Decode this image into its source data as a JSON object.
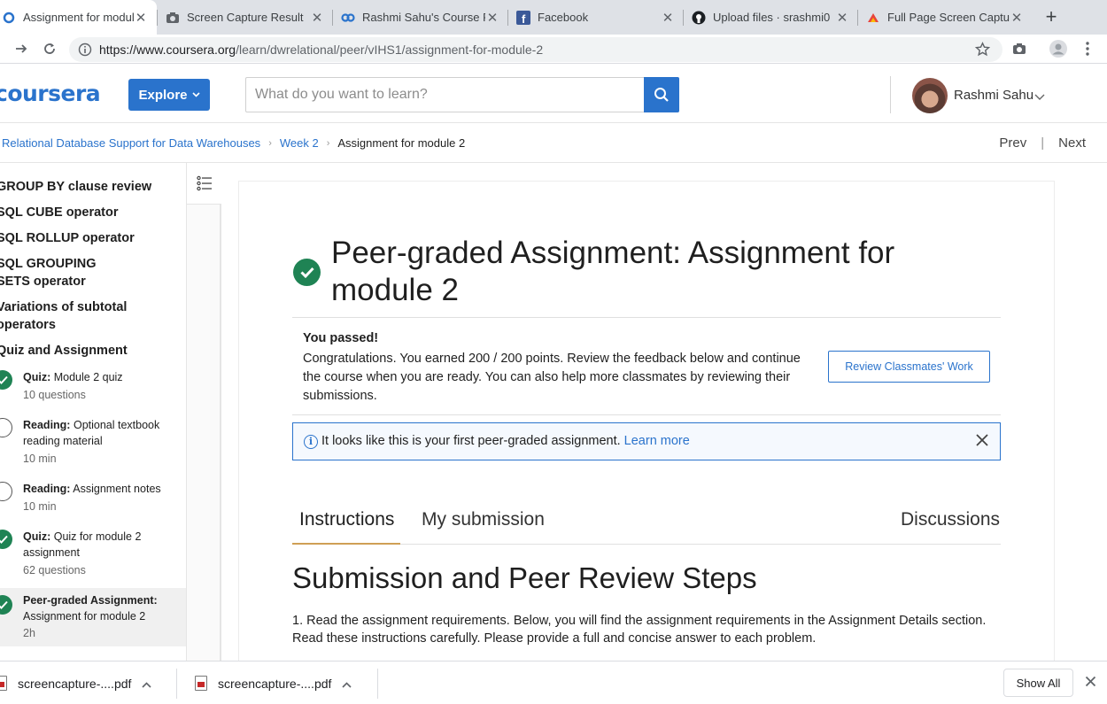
{
  "browser": {
    "tabs": [
      {
        "title": "Assignment for module",
        "active": true
      },
      {
        "title": "Screen Capture Result"
      },
      {
        "title": "Rashmi Sahu's Course F"
      },
      {
        "title": "Facebook"
      },
      {
        "title": "Upload files · srashmi0"
      },
      {
        "title": "Full Page Screen Captu"
      }
    ],
    "url_host": "https://www.coursera.org",
    "url_path": "/learn/dwrelational/peer/vIHS1/assignment-for-module-2"
  },
  "header": {
    "logo": "coursera",
    "explore_label": "Explore",
    "search_placeholder": "What do you want to learn?",
    "user_name": "Rashmi Sahu"
  },
  "breadcrumb": {
    "course": "Relational Database Support for Data Warehouses",
    "week": "Week 2",
    "current": "Assignment for module 2",
    "prev": "Prev",
    "next": "Next"
  },
  "sidebar": {
    "headings": [
      "GROUP BY clause review",
      "SQL CUBE operator",
      "SQL ROLLUP operator",
      "SQL GROUPING SETS operator",
      "Variations of subtotal operators",
      "Quiz and Assignment"
    ],
    "items": [
      {
        "type": "Quiz:",
        "title": "Module 2 quiz",
        "meta": "10 questions",
        "status": "done"
      },
      {
        "type": "Reading:",
        "title": "Optional textbook reading material",
        "meta": "10 min",
        "status": "reading"
      },
      {
        "type": "Reading:",
        "title": "Assignment notes",
        "meta": "10 min",
        "status": "reading"
      },
      {
        "type": "Quiz:",
        "title": "Quiz for module 2 assignment",
        "meta": "62 questions",
        "status": "done"
      },
      {
        "type": "Peer-graded Assignment:",
        "title": "Assignment for module 2",
        "meta": "2h",
        "status": "done"
      }
    ]
  },
  "main": {
    "title": "Peer-graded Assignment: Assignment for module 2",
    "passed_title": "You passed!",
    "passed_text": "Congratulations. You earned 200 / 200 points. Review the feedback below and continue the course when you are ready. You can also help more classmates by reviewing their submissions.",
    "review_button": "Review Classmates' Work",
    "info_message": "It looks like this is your first peer-graded assignment.",
    "info_link": "Learn more",
    "tabs": [
      "Instructions",
      "My submission",
      "Discussions"
    ],
    "section_title": "Submission and Peer Review Steps",
    "section_text": "1. Read the assignment requirements. Below, you will find the assignment requirements in the Assignment Details section. Read these instructions carefully. Please provide a full and concise answer to each problem."
  },
  "downloads": {
    "files": [
      "screencapture-....pdf",
      "screencapture-....pdf"
    ],
    "show_all": "Show All"
  },
  "colors": {
    "brand_blue": "#2a73cc",
    "success_green": "#1f8354",
    "tab_underline": "#cf9f55"
  }
}
